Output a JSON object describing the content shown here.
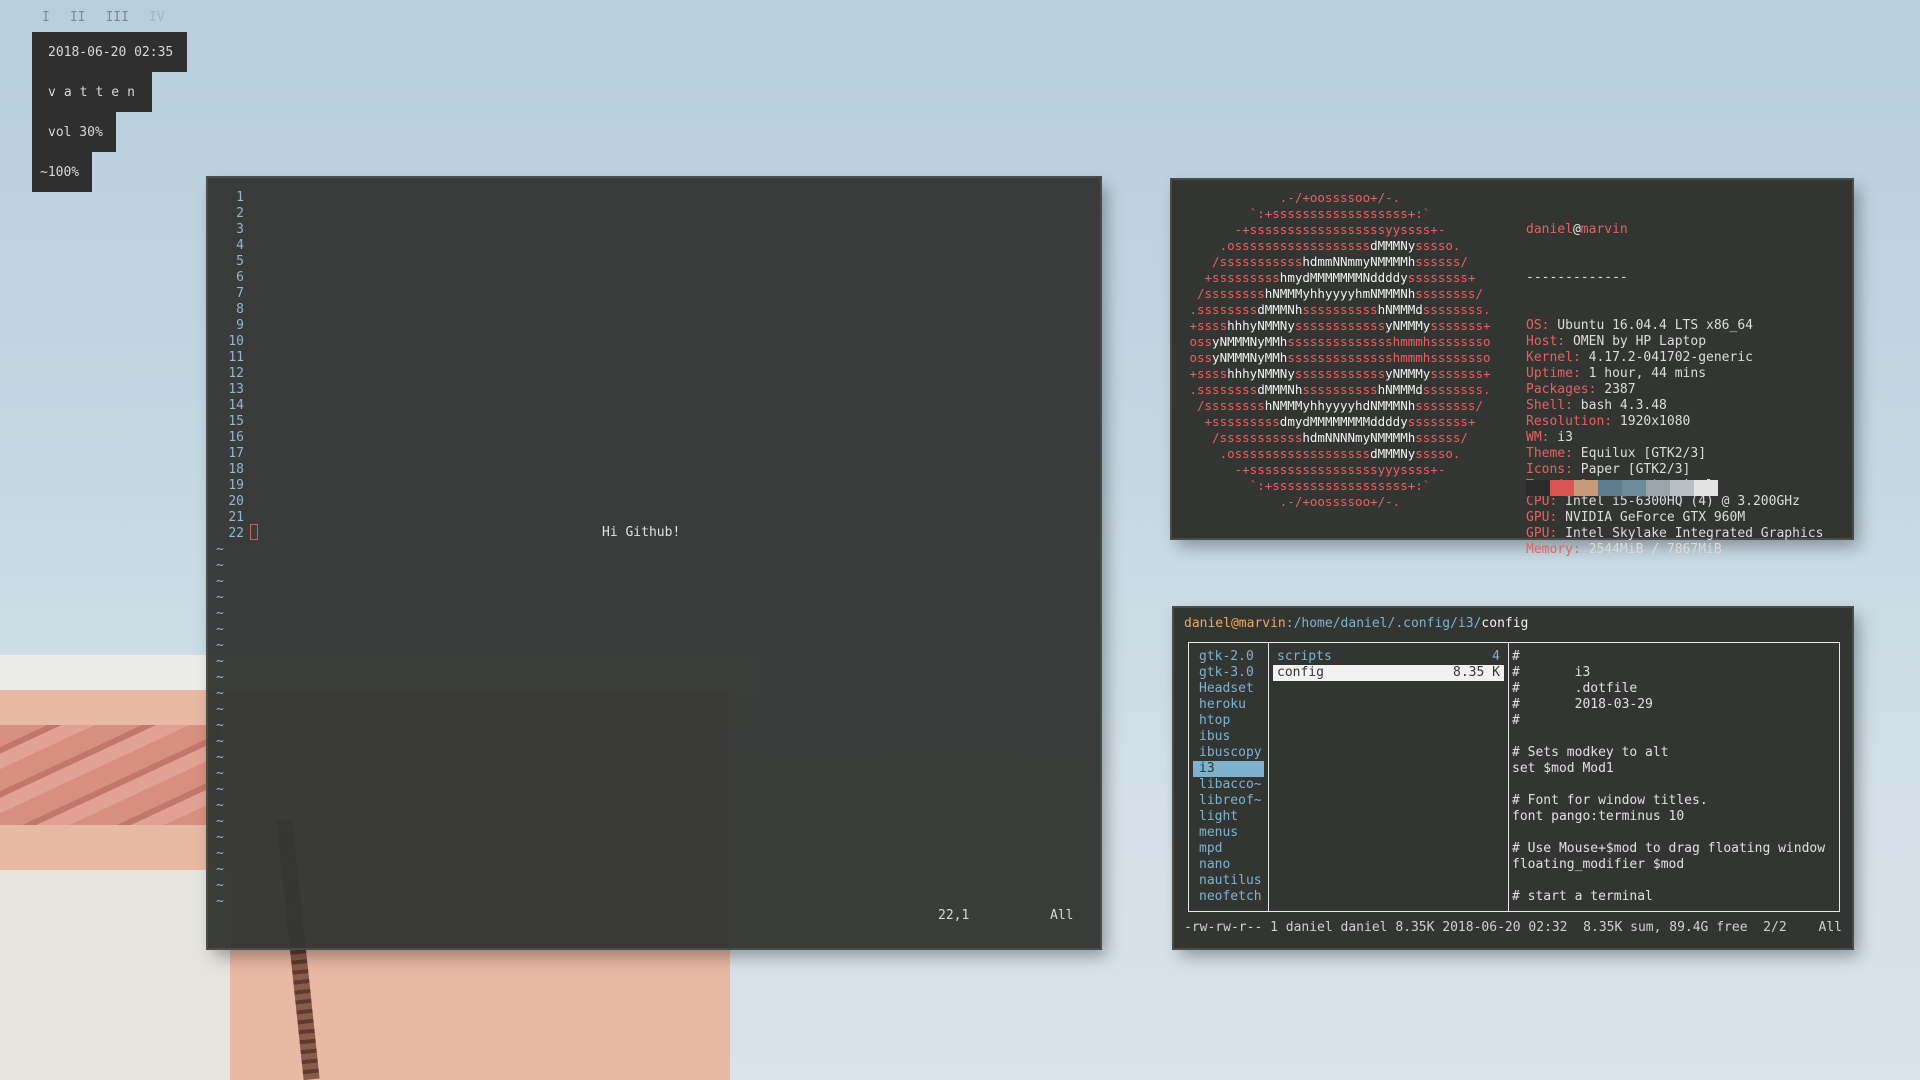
{
  "workspaces": [
    "I",
    "II",
    "III",
    "IV"
  ],
  "status": {
    "datetime": "2018-06-20 02:35",
    "hostname": "vatten",
    "volume": "vol 30%",
    "battery": "~100%"
  },
  "vim": {
    "line_numbers": [
      "1",
      "2",
      "3",
      "4",
      "5",
      "6",
      "7",
      "8",
      "9",
      "10",
      "11",
      "12",
      "13",
      "14",
      "15",
      "16",
      "17",
      "18",
      "19",
      "20",
      "21",
      "22"
    ],
    "tilde_count": 23,
    "text": "Hi Github!",
    "position": "22,1",
    "scroll": "All"
  },
  "neofetch": {
    "ascii": [
      ".-/+oossssoo+/-.",
      "`:+ssssssssssssssssss+:`",
      "-+ssssssssssssssssssyyssss+-",
      ".ossssssssssssssssssdMMMNysssso.",
      "/ssssssssssshdmmNNmmyNMMMMhssssss/",
      "+ssssssssshmydMMMMMMMNddddyssssssss+",
      "/sssssssshNMMMyhhyyyyhmNMMMNhssssssss/",
      ".ssssssssdMMMNhsssssssssshNMMMdssssssss.",
      "+sssshhhyNMMNyssssssssssssyNMMMysssssss+",
      "ossyNMMMNyMMhsssssssssssssshmmmhssssssso",
      "ossyNMMMNyMMhsssssssssssssshmmmhssssssso",
      "+sssshhhyNMMNyssssssssssssyNMMMysssssss+",
      ".ssssssssdMMMNhsssssssssshNMMMdssssssss.",
      "/sssssssshNMMMyhhyyyyhdNMMMNhssssssss/",
      "+sssssssssdmydMMMMMMMMddddyssssssss+",
      "/ssssssssssshdmNNNNmyNMMMMhssssss/",
      ".ossssssssssssssssssdMMMNysssso.",
      "-+sssssssssssssssssyyyssss+-",
      "`:+ssssssssssssssssss+:`",
      ".-/+oossssoo+/-."
    ],
    "user": "daniel",
    "host": "marvin",
    "separator": "-------------",
    "fields": [
      {
        "key": "OS",
        "value": "Ubuntu 16.04.4 LTS x86_64"
      },
      {
        "key": "Host",
        "value": "OMEN by HP Laptop"
      },
      {
        "key": "Kernel",
        "value": "4.17.2-041702-generic"
      },
      {
        "key": "Uptime",
        "value": "1 hour, 44 mins"
      },
      {
        "key": "Packages",
        "value": "2387"
      },
      {
        "key": "Shell",
        "value": "bash 4.3.48"
      },
      {
        "key": "Resolution",
        "value": "1920x1080"
      },
      {
        "key": "WM",
        "value": "i3"
      },
      {
        "key": "Theme",
        "value": "Equilux [GTK2/3]"
      },
      {
        "key": "Icons",
        "value": "Paper [GTK2/3]"
      },
      {
        "key": "Terminal",
        "value": "gnome-terminal"
      },
      {
        "key": "CPU",
        "value": "Intel i5-6300HQ (4) @ 3.200GHz"
      },
      {
        "key": "GPU",
        "value": "NVIDIA GeForce GTX 960M"
      },
      {
        "key": "GPU",
        "value": "Intel Skylake Integrated Graphics"
      },
      {
        "key": "Memory",
        "value": "2544MiB / 7867MiB"
      }
    ],
    "palette": [
      "#2b2b2b",
      "#d9534f",
      "#c99a78",
      "#5f7d8e",
      "#6d8c9c",
      "#9aa5ab",
      "#b9c0c4",
      "#e3e3e3"
    ]
  },
  "ranger": {
    "title_user": "daniel@marvin",
    "title_path": ":/home/daniel/.config/i3/",
    "title_file": "config",
    "dirs": [
      "gtk-2.0",
      "gtk-3.0",
      "Headset",
      "heroku",
      "htop",
      "ibus",
      "ibuscopy",
      "i3",
      "libacco~",
      "libreof~",
      "light",
      "menus",
      "mpd",
      "nano",
      "nautilus",
      "neofetch"
    ],
    "selected_dir": "i3",
    "files": [
      {
        "name": "scripts",
        "size": "4"
      },
      {
        "name": "config",
        "size": "8.35 K"
      }
    ],
    "selected_file": "config",
    "preview": [
      "#",
      "#       i3",
      "#       .dotfile",
      "#       2018-03-29",
      "#",
      "",
      "# Sets modkey to alt",
      "set $mod Mod1",
      "",
      "# Font for window titles.",
      "font pango:terminus 10",
      "",
      "# Use Mouse+$mod to drag floating window",
      "floating_modifier $mod",
      "",
      "# start a terminal"
    ],
    "status": "-rw-rw-r-- 1 daniel daniel 8.35K 2018-06-20 02:32  8.35K sum, 89.4G free  2/2",
    "scroll": "All"
  }
}
